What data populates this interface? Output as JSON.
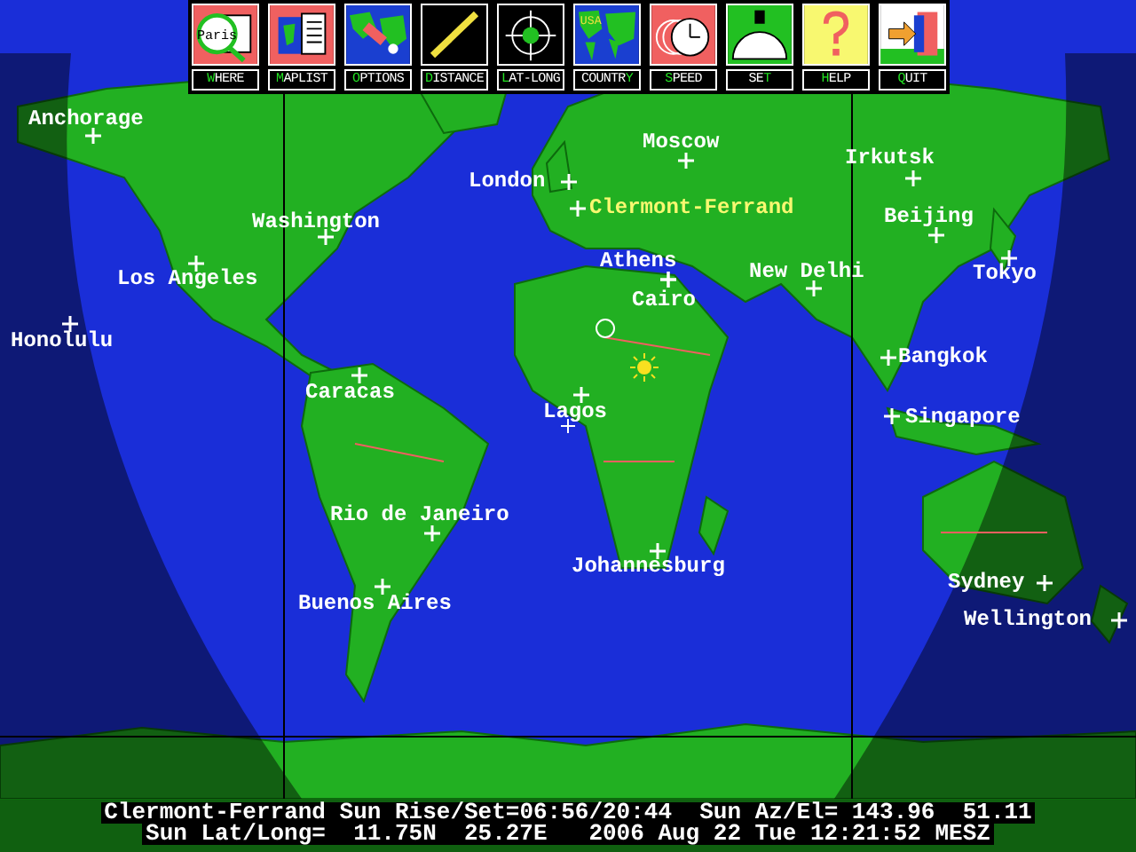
{
  "toolbar": [
    {
      "key": "W",
      "after": "HERE",
      "kind": "where"
    },
    {
      "key": "M",
      "after": "APLIST",
      "kind": "maplist"
    },
    {
      "key": "O",
      "after": "PTIONS",
      "kind": "options"
    },
    {
      "key": "D",
      "after": "ISTANCE",
      "kind": "distance"
    },
    {
      "key": "L",
      "after": "AT-LONG",
      "kind": "latlong"
    },
    {
      "before": "COUNTR",
      "key": "Y",
      "kind": "country"
    },
    {
      "key": "S",
      "after": "PEED",
      "kind": "speed"
    },
    {
      "before": "SE",
      "key": "T",
      "kind": "set"
    },
    {
      "key": "H",
      "after": "ELP",
      "kind": "help"
    },
    {
      "key": "Q",
      "after": "UIT",
      "kind": "quit"
    }
  ],
  "map": {
    "paris_label": "Paris",
    "usa_label": "USA",
    "cities": [
      {
        "name": "Anchorage",
        "selected": false
      },
      {
        "name": "Moscow",
        "selected": false
      },
      {
        "name": "Irkutsk",
        "selected": false
      },
      {
        "name": "London",
        "selected": false
      },
      {
        "name": "Clermont-Ferrand",
        "selected": true
      },
      {
        "name": "Washington",
        "selected": false
      },
      {
        "name": "Beijing",
        "selected": false
      },
      {
        "name": "Athens",
        "selected": false
      },
      {
        "name": "Los Angeles",
        "selected": false
      },
      {
        "name": "New Delhi",
        "selected": false
      },
      {
        "name": "Tokyo",
        "selected": false
      },
      {
        "name": "Cairo",
        "selected": false
      },
      {
        "name": "Honolulu",
        "selected": false
      },
      {
        "name": "Caracas",
        "selected": false
      },
      {
        "name": "Bangkok",
        "selected": false
      },
      {
        "name": "Lagos",
        "selected": false
      },
      {
        "name": "Singapore",
        "selected": false
      },
      {
        "name": "Rio de Janeiro",
        "selected": false
      },
      {
        "name": "Johannesburg",
        "selected": false
      },
      {
        "name": "Sydney",
        "selected": false
      },
      {
        "name": "Buenos Aires",
        "selected": false
      },
      {
        "name": "Wellington",
        "selected": false
      }
    ]
  },
  "status_bar": [
    "Clermont-Ferrand Sun Rise/Set=06:56/20:44  Sun Az/El= 143.96  51.11",
    "Sun Lat/Long=  11.75N  25.27E   2006 Aug 22 Tue 12:21:52 MESZ"
  ]
}
